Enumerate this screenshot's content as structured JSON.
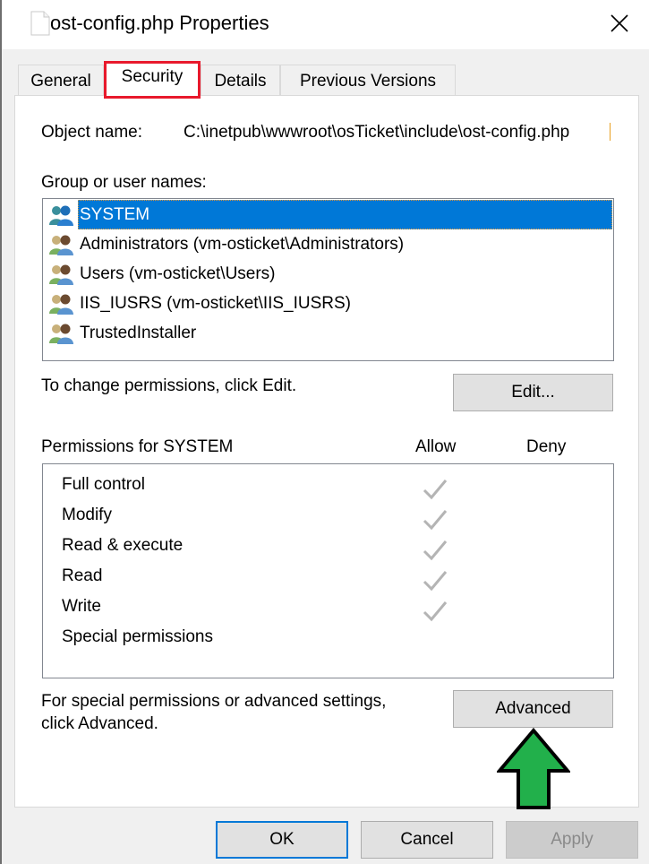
{
  "window": {
    "title": "ost-config.php Properties",
    "title_icon": "file-icon",
    "close_icon": "close-icon"
  },
  "tabs": [
    {
      "label": "General",
      "active": false
    },
    {
      "label": "Security",
      "active": true,
      "highlighted": true
    },
    {
      "label": "Details",
      "active": false
    },
    {
      "label": "Previous Versions",
      "active": false
    }
  ],
  "security": {
    "object_name_label": "Object name:",
    "object_name_value": "C:\\inetpub\\wwwroot\\osTicket\\include\\ost-config.php",
    "group_label": "Group or user names:",
    "principals": [
      {
        "name": "SYSTEM",
        "icon": "system-users-icon",
        "selected": true
      },
      {
        "name": "Administrators (vm-osticket\\Administrators)",
        "icon": "users-icon",
        "selected": false
      },
      {
        "name": "Users (vm-osticket\\Users)",
        "icon": "users-icon",
        "selected": false
      },
      {
        "name": "IIS_IUSRS (vm-osticket\\IIS_IUSRS)",
        "icon": "users-icon",
        "selected": false
      },
      {
        "name": "TrustedInstaller",
        "icon": "users-icon",
        "selected": false
      }
    ],
    "change_hint": "To change permissions, click Edit.",
    "edit_button": "Edit...",
    "permissions_header": "Permissions for SYSTEM",
    "allow_header": "Allow",
    "deny_header": "Deny",
    "permissions": [
      {
        "name": "Full control",
        "allow": true,
        "deny": false
      },
      {
        "name": "Modify",
        "allow": true,
        "deny": false
      },
      {
        "name": "Read & execute",
        "allow": true,
        "deny": false
      },
      {
        "name": "Read",
        "allow": true,
        "deny": false
      },
      {
        "name": "Write",
        "allow": true,
        "deny": false
      },
      {
        "name": "Special permissions",
        "allow": false,
        "deny": false
      }
    ],
    "advanced_hint_line1": "For special permissions or advanced settings,",
    "advanced_hint_line2": "click Advanced.",
    "advanced_button": "Advanced"
  },
  "footer": {
    "ok": "OK",
    "cancel": "Cancel",
    "apply": "Apply",
    "apply_disabled": true
  },
  "annotations": {
    "highlight_color": "#e8192c",
    "arrow_color": "#22b04b",
    "arrow_target": "advanced-button"
  },
  "colors": {
    "selection": "#0078d7",
    "check": "#b4b4b4"
  }
}
